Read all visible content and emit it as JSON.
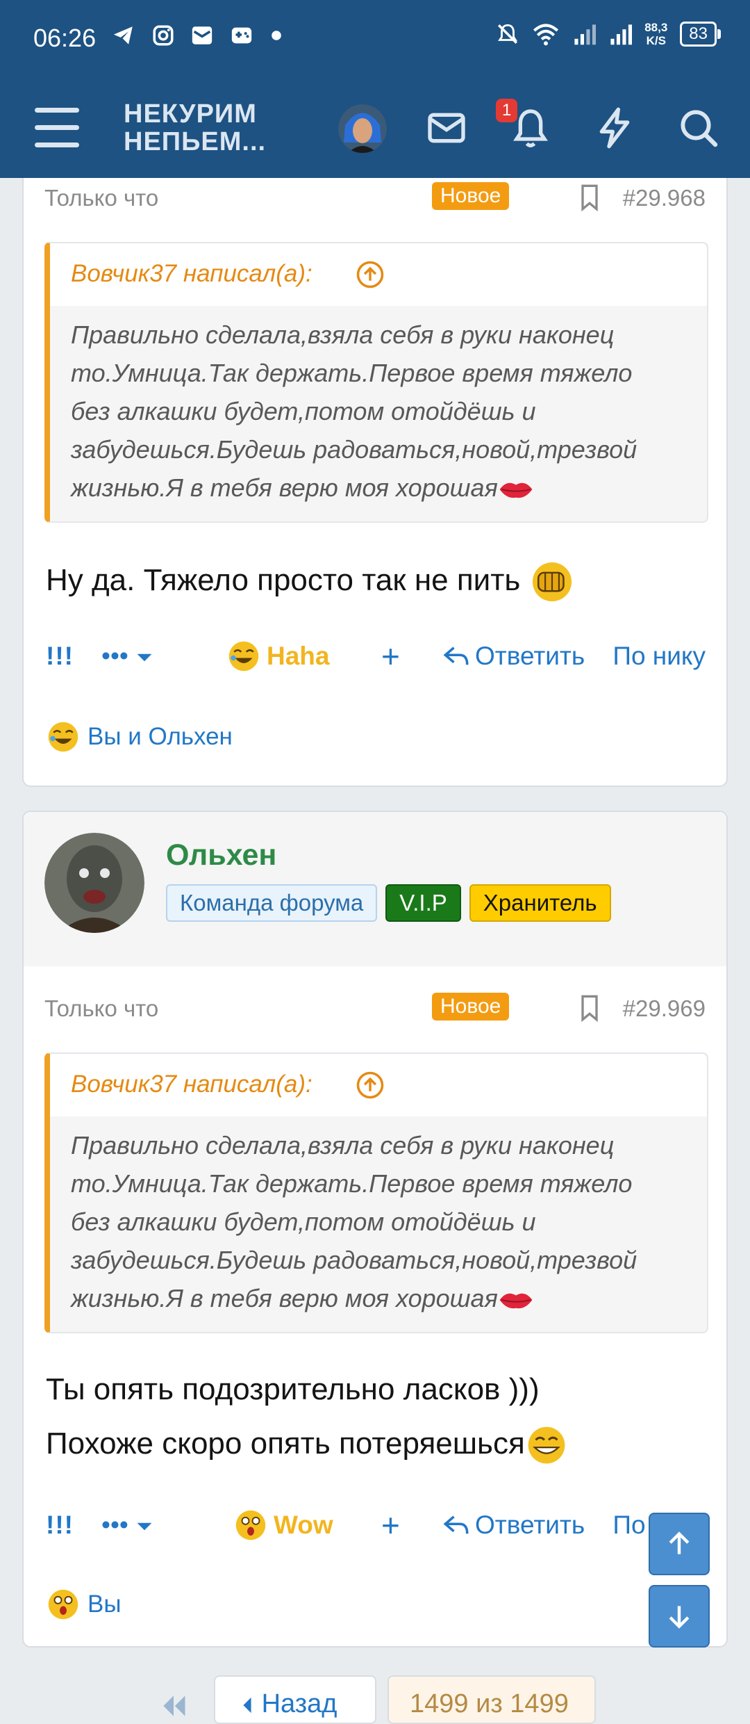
{
  "status_bar": {
    "time": "06:26",
    "net_speed_value": "88,3",
    "net_speed_unit": "K/S",
    "battery": "83",
    "icons": [
      "telegram-icon",
      "instagram-icon",
      "mail-icon",
      "gamepad-icon",
      "dot-icon",
      "bell-off-icon",
      "wifi-icon",
      "signal-icon",
      "signal-icon"
    ]
  },
  "header": {
    "logo_line1": "НЕКУРИМ",
    "logo_line2": "НЕПЬЕМ...",
    "notifications_count": "1",
    "colors": {
      "background": "#1d5282",
      "accent": "#dbe6f1"
    }
  },
  "posts": [
    {
      "time": "Только что",
      "new_label": "Новое",
      "number": "#29.968",
      "quote_author": "Вовчик37 написал(а):",
      "quote_lines": [
        "Правильно сделала,взяла себя в руки наконец",
        "то.Умница.Так держать.Первое время тяжело",
        "без алкашки будет,потом отойдёшь и",
        "забудешься.Будешь радоваться,новой,трезвой",
        "жизнью.Я в тебя верю моя хорошая"
      ],
      "text_lines": [
        "Ну да. Тяжело просто так не пить "
      ],
      "actions": {
        "mark": "!!!",
        "more": "•••",
        "reaction_label": "Haha",
        "plus": "+",
        "reply": "Ответить",
        "by_nick": "По нику"
      },
      "reacted_by": "Вы и Ольхен"
    },
    {
      "user": {
        "name": "Ольхен",
        "badges": [
          "Команда форума",
          "V.I.P",
          "Хранитель"
        ]
      },
      "time": "Только что",
      "new_label": "Новое",
      "number": "#29.969",
      "quote_author": "Вовчик37 написал(а):",
      "quote_lines": [
        "Правильно сделала,взяла себя в руки наконец",
        "то.Умница.Так держать.Первое время тяжело",
        "без алкашки будет,потом отойдёшь и",
        "забудешься.Будешь радоваться,новой,трезвой",
        "жизнью.Я в тебя верю моя хорошая"
      ],
      "text_lines": [
        "Ты опять подозрительно ласков )))",
        "Похоже скоро опять потеряешься"
      ],
      "actions": {
        "mark": "!!!",
        "more": "•••",
        "reaction_label": "Wow",
        "plus": "+",
        "reply": "Ответить",
        "by_nick": "По нику"
      },
      "reacted_by": "Вы"
    }
  ],
  "pagination": {
    "back_label": "Назад",
    "count_label": "1499 из 1499"
  }
}
